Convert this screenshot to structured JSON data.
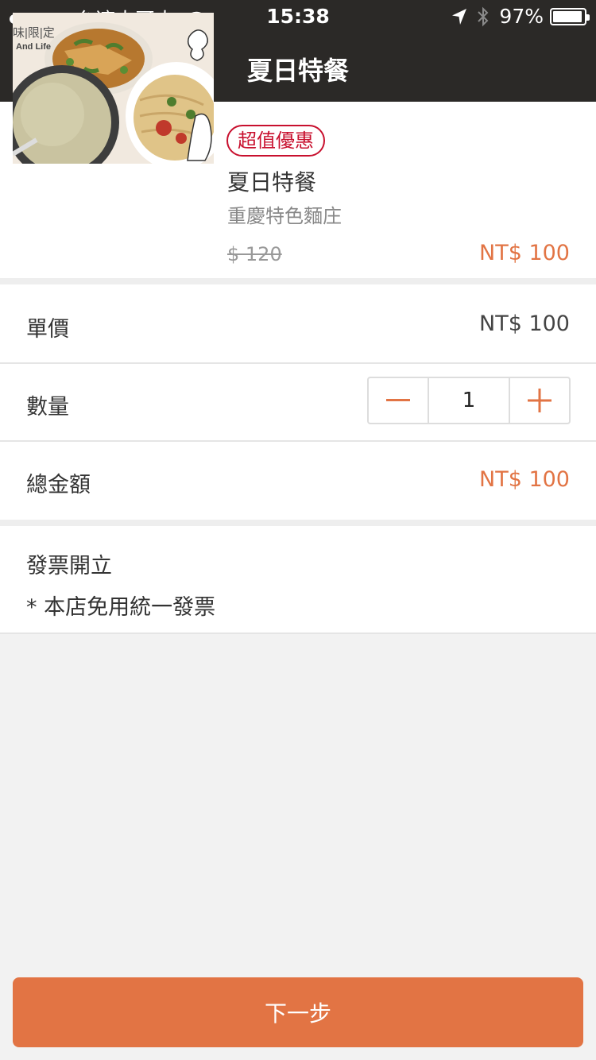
{
  "status_bar": {
    "carrier": "台湾大哥大",
    "time": "15:38",
    "battery_percent": "97%",
    "signal_bars_filled": 4,
    "signal_bars_total": 5
  },
  "nav": {
    "title": "夏日特餐",
    "back_icon": "chevron-left-icon"
  },
  "product": {
    "badge": "超值優惠",
    "name": "夏日特餐",
    "store": "重慶特色麵庄",
    "original_price": "$ 120",
    "price": "NT$ 100",
    "image_text_line1": "味|限|定",
    "image_text_line2": "And Life"
  },
  "unit_price": {
    "label": "單價",
    "value": "NT$ 100"
  },
  "quantity": {
    "label": "數量",
    "value": "1",
    "decrement_icon": "minus-icon",
    "increment_icon": "plus-icon"
  },
  "total": {
    "label": "總金額",
    "value": "NT$ 100"
  },
  "invoice": {
    "title": "發票開立",
    "note": "* 本店免用統一發票"
  },
  "next_button": {
    "label": "下一步"
  },
  "colors": {
    "nav_bg": "#2b2927",
    "accent": "#e27444",
    "badge": "#c8102e",
    "page_bg": "#f2f2f2"
  }
}
